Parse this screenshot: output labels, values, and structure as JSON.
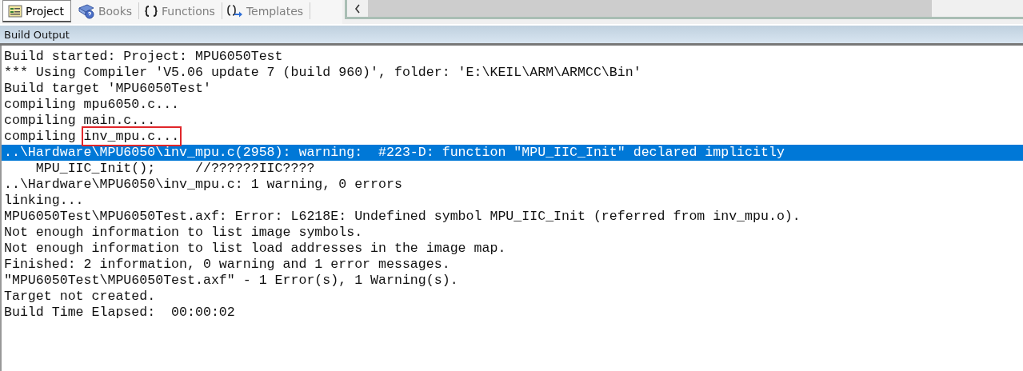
{
  "tabs": [
    {
      "label": "Project",
      "selected": true
    },
    {
      "label": "Books",
      "selected": false
    },
    {
      "label": "Functions",
      "selected": false
    },
    {
      "label": "Templates",
      "selected": false
    }
  ],
  "panel": {
    "title": "Build Output"
  },
  "lines": [
    {
      "text": "Build started: Project: MPU6050Test",
      "selected": false,
      "annotated": false
    },
    {
      "text": "*** Using Compiler 'V5.06 update 7 (build 960)', folder: 'E:\\KEIL\\ARM\\ARMCC\\Bin'",
      "selected": false,
      "annotated": false
    },
    {
      "text": "Build target 'MPU6050Test'",
      "selected": false,
      "annotated": false
    },
    {
      "text": "compiling mpu6050.c...",
      "selected": false,
      "annotated": false
    },
    {
      "text": "compiling main.c...",
      "selected": false,
      "annotated": false
    },
    {
      "text": "compiling inv_mpu.c...",
      "selected": false,
      "annotated": true
    },
    {
      "text": "..\\Hardware\\MPU6050\\inv_mpu.c(2958): warning:  #223-D: function \"MPU_IIC_Init\" declared implicitly",
      "selected": true,
      "annotated": false
    },
    {
      "text": "    MPU_IIC_Init();     //??????IIC????",
      "selected": false,
      "annotated": false
    },
    {
      "text": "..\\Hardware\\MPU6050\\inv_mpu.c: 1 warning, 0 errors",
      "selected": false,
      "annotated": false
    },
    {
      "text": "linking...",
      "selected": false,
      "annotated": false
    },
    {
      "text": "MPU6050Test\\MPU6050Test.axf: Error: L6218E: Undefined symbol MPU_IIC_Init (referred from inv_mpu.o).",
      "selected": false,
      "annotated": false
    },
    {
      "text": "Not enough information to list image symbols.",
      "selected": false,
      "annotated": false
    },
    {
      "text": "Not enough information to list load addresses in the image map.",
      "selected": false,
      "annotated": false
    },
    {
      "text": "Finished: 2 information, 0 warning and 1 error messages.",
      "selected": false,
      "annotated": false
    },
    {
      "text": "\"MPU6050Test\\MPU6050Test.axf\" - 1 Error(s), 1 Warning(s).",
      "selected": false,
      "annotated": false
    },
    {
      "text": "Target not created.",
      "selected": false,
      "annotated": false
    },
    {
      "text": "Build Time Elapsed:  00:00:02",
      "selected": false,
      "annotated": false
    }
  ]
}
